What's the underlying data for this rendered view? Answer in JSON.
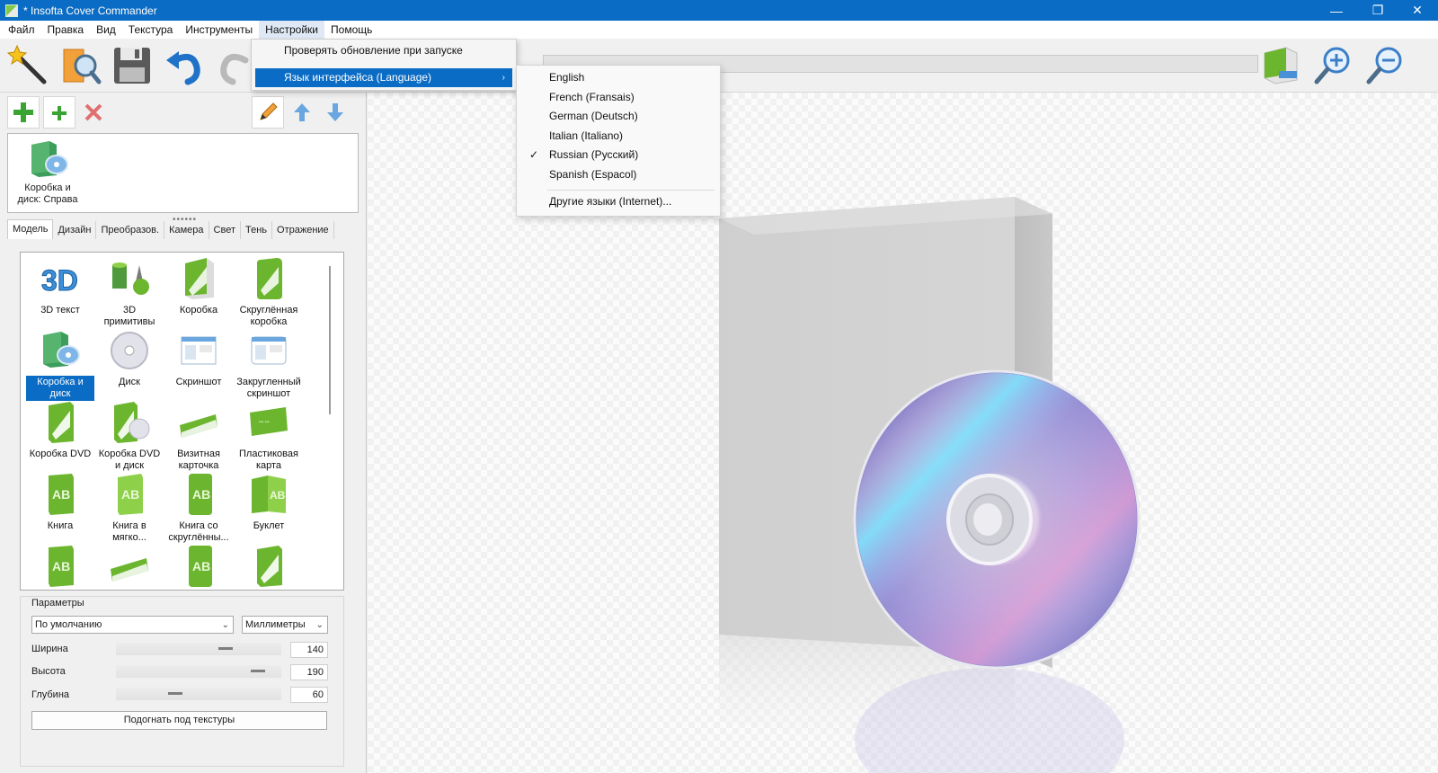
{
  "window": {
    "title": "* Insofta Cover Commander",
    "minimize": "—",
    "restore": "❐",
    "close": "✕"
  },
  "menubar": [
    "Файл",
    "Правка",
    "Вид",
    "Текстура",
    "Инструменты",
    "Настройки",
    "Помощь"
  ],
  "settings_menu": {
    "check_updates": "Проверять обновление при запуске",
    "language": "Язык интерфейса (Language)",
    "submenu_arrow": "›"
  },
  "language_menu": {
    "items": [
      "English",
      "French (Fransais)",
      "German (Deutsch)",
      "Italian (Italiano)",
      "Russian (Русский)",
      "Spanish (Espacol)"
    ],
    "checked_index": 4,
    "check_mark": "✓",
    "other": "Другие языки (Internet)..."
  },
  "scene": {
    "item_label": "Коробка и диск: Справа"
  },
  "tabs": [
    "Модель",
    "Дизайн",
    "Преобразов.",
    "Камера",
    "Свет",
    "Тень",
    "Отражение"
  ],
  "models": [
    {
      "label": "3D текст",
      "icon": "3d-text-icon"
    },
    {
      "label": "3D примитивы",
      "icon": "3d-primitives-icon"
    },
    {
      "label": "Коробка",
      "icon": "box-icon"
    },
    {
      "label": "Скруглённая коробка",
      "icon": "rounded-box-icon"
    },
    {
      "label": "Коробка и диск",
      "icon": "box-and-disc-icon"
    },
    {
      "label": "Диск",
      "icon": "disc-icon"
    },
    {
      "label": "Скриншот",
      "icon": "screenshot-icon"
    },
    {
      "label": "Закругленный скриншот",
      "icon": "rounded-screenshot-icon"
    },
    {
      "label": "Коробка DVD",
      "icon": "dvd-box-icon"
    },
    {
      "label": "Коробка DVD и диск",
      "icon": "dvd-box-and-disc-icon"
    },
    {
      "label": "Визитная карточка",
      "icon": "business-card-icon"
    },
    {
      "label": "Пластиковая карта",
      "icon": "plastic-card-icon"
    },
    {
      "label": "Книга",
      "icon": "book-icon"
    },
    {
      "label": "Книга в мягко...",
      "icon": "softcover-book-icon"
    },
    {
      "label": "Книга со скруглённы...",
      "icon": "rounded-book-icon"
    },
    {
      "label": "Буклет",
      "icon": "booklet-icon"
    }
  ],
  "selected_model_index": 4,
  "params": {
    "title": "Параметры",
    "preset": "По умолчанию",
    "units": "Миллиметры",
    "width_label": "Ширина",
    "width": "140",
    "height_label": "Высота",
    "height": "190",
    "depth_label": "Глубина",
    "depth": "60",
    "fit_button": "Подогнать под текстуры"
  },
  "colors": {
    "titlebar": "#0a6cc4",
    "accent_green": "#6cb52e",
    "delete_red": "#e04a4a",
    "arrow_blue": "#4a90d8"
  }
}
